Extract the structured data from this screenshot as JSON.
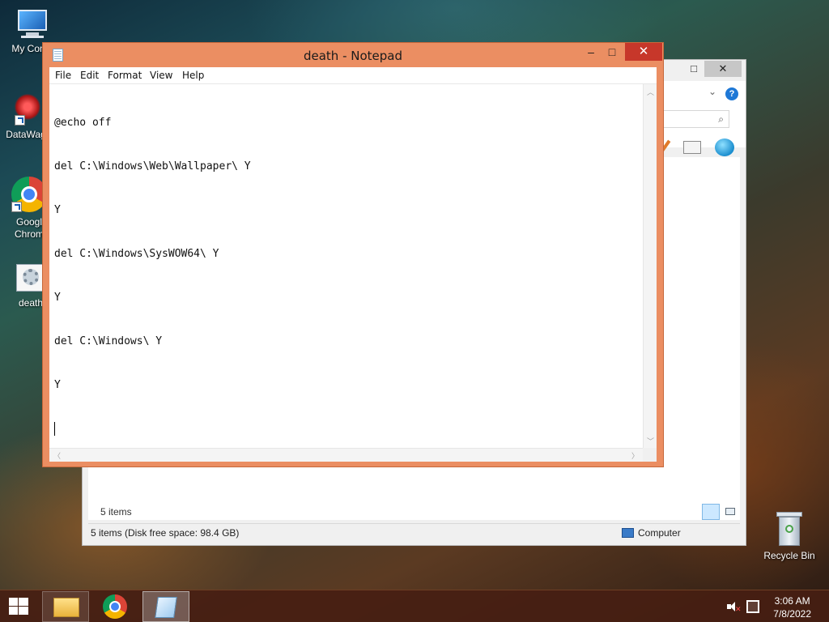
{
  "desktop": {
    "icons": [
      {
        "label": "My Comp"
      },
      {
        "label": "DataWag"
      },
      {
        "label": "Googl Chrom"
      },
      {
        "label": "death"
      },
      {
        "label": "Recycle Bin"
      }
    ]
  },
  "notepad": {
    "title": "death - Notepad",
    "menu": [
      "File",
      "Edit",
      "Format",
      "View",
      "Help"
    ],
    "lines": [
      "@echo off",
      "del C:\\Windows\\Web\\Wallpaper\\ Y",
      "Y",
      "del C:\\Windows\\SysWOW64\\ Y",
      "Y",
      "del C:\\Windows\\ Y",
      "Y"
    ],
    "buttons": {
      "minimize": "–",
      "maximize": "□",
      "close": "✕"
    }
  },
  "explorer": {
    "item_count": "5 items",
    "status_left": "5 items (Disk free space: 98.4 GB)",
    "status_right": "Computer",
    "help_glyph": "?"
  },
  "taskbar": {
    "time": "3:06 AM",
    "date": "7/8/2022",
    "items": [
      "start-icon",
      "file-explorer-icon",
      "chrome-icon",
      "notepad-icon"
    ]
  },
  "colors": {
    "notepad_frame": "#eb8e62",
    "close_button": "#c7372a",
    "taskbar": "#461e12"
  }
}
